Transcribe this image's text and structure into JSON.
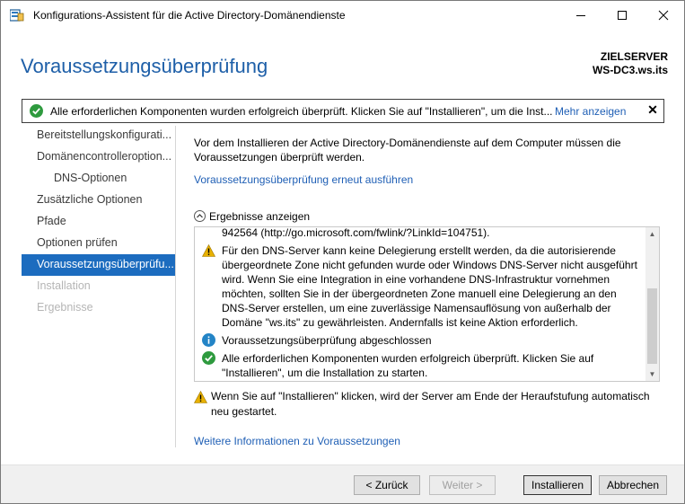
{
  "window": {
    "title": "Konfigurations-Assistent für die Active Directory-Domänendienste"
  },
  "header": {
    "page_title": "Voraussetzungsüberprüfung",
    "target_label": "ZIELSERVER",
    "target_server": "WS-DC3.ws.its"
  },
  "notice": {
    "text": "Alle erforderlichen Komponenten wurden erfolgreich überprüft. Klicken Sie auf \"Installieren\", um die Inst...",
    "more_link": "Mehr anzeigen",
    "close": "✕"
  },
  "nav": {
    "items": [
      {
        "label": "Bereitstellungskonfigurati...",
        "state": "normal"
      },
      {
        "label": "Domänencontrolleroption...",
        "state": "normal"
      },
      {
        "label": "DNS-Optionen",
        "state": "sub"
      },
      {
        "label": "Zusätzliche Optionen",
        "state": "normal"
      },
      {
        "label": "Pfade",
        "state": "normal"
      },
      {
        "label": "Optionen prüfen",
        "state": "normal"
      },
      {
        "label": "Voraussetzungsüberprüfu...",
        "state": "active"
      },
      {
        "label": "Installation",
        "state": "disabled"
      },
      {
        "label": "Ergebnisse",
        "state": "disabled"
      }
    ]
  },
  "content": {
    "intro": "Vor dem Installieren der Active Directory-Domänendienste auf dem Computer müssen die Voraussetzungen überprüft werden.",
    "rerun_link": "Voraussetzungsüberprüfung erneut ausführen",
    "results_toggle": "Ergebnisse anzeigen",
    "results": [
      {
        "icon": "none",
        "text": "942564 (http://go.microsoft.com/fwlink/?LinkId=104751)."
      },
      {
        "icon": "warning",
        "text": "Für den DNS-Server kann keine Delegierung erstellt werden, da die autorisierende übergeordnete Zone nicht gefunden wurde oder Windows DNS-Server nicht ausgeführt wird. Wenn Sie eine Integration in eine vorhandene DNS-Infrastruktur vornehmen möchten, sollten Sie in der übergeordneten Zone manuell eine Delegierung an den DNS-Server erstellen, um eine zuverlässige Namensauflösung von außerhalb der Domäne \"ws.its\" zu gewährleisten. Andernfalls ist keine Aktion erforderlich."
      },
      {
        "icon": "info",
        "text": "Voraussetzungsüberprüfung abgeschlossen"
      },
      {
        "icon": "success",
        "text": "Alle erforderlichen Komponenten wurden erfolgreich überprüft. Klicken Sie auf \"Installieren\", um die Installation zu starten."
      }
    ],
    "restart_warning": "Wenn Sie auf \"Installieren\" klicken, wird der Server am Ende der Heraufstufung automatisch neu gestartet.",
    "more_info_link": "Weitere Informationen zu Voraussetzungen"
  },
  "footer": {
    "back": "< Zurück",
    "next": "Weiter >",
    "install": "Installieren",
    "cancel": "Abbrechen"
  },
  "colors": {
    "accent": "#1c6cbf",
    "title_blue": "#1e5fa8",
    "link": "#1f5fb5",
    "success": "#2e9a3e",
    "warning": "#e8b100",
    "info": "#2384c6"
  }
}
